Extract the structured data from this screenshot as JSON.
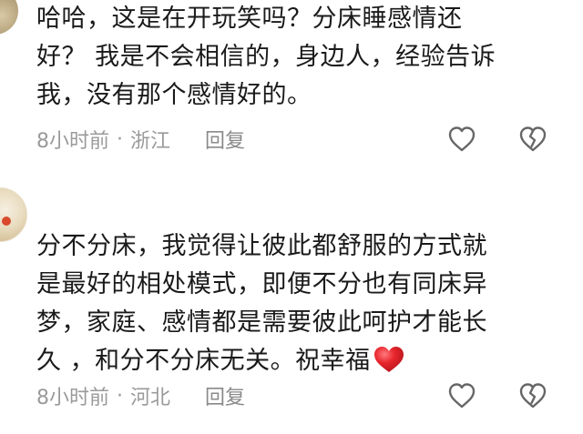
{
  "comments": [
    {
      "lines": [
        "哈哈，这是在开玩笑吗？分床睡感情还",
        "好？ 我是不会相信的，身边人，经验告诉",
        "我，没有那个感情好的。"
      ],
      "time": "8小时前",
      "separator": "·",
      "location": "浙江",
      "reply_label": "回复"
    },
    {
      "lines": [
        "分不分床，我觉得让彼此都舒服的方式就",
        "是最好的相处模式，即便不分也有同床异",
        "梦，家庭、感情都是需要彼此呵护才能长",
        "久 ，和分不分床无关。祝幸福"
      ],
      "emoji": "red-heart-emoji",
      "time": "8小时前",
      "separator": "·",
      "location": "河北",
      "reply_label": "回复"
    }
  ],
  "icons": {
    "like": "heart-outline-icon",
    "dislike": "broken-heart-outline-icon"
  },
  "colors": {
    "text": "#1a1a1a",
    "meta": "#9a9a9a",
    "icon": "#666666",
    "emoji_heart": "#e8262d"
  }
}
